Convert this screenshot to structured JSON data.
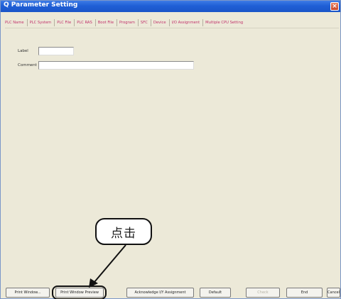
{
  "window": {
    "title": "Q Parameter Setting",
    "close_glyph": "×"
  },
  "tabs": [
    {
      "label": "PLC Name"
    },
    {
      "label": "PLC System"
    },
    {
      "label": "PLC File"
    },
    {
      "label": "PLC RAS"
    },
    {
      "label": "Boot File"
    },
    {
      "label": "Program"
    },
    {
      "label": "SFC"
    },
    {
      "label": "Device"
    },
    {
      "label": "I/O Assignment"
    },
    {
      "label": "Multiple CPU Setting"
    }
  ],
  "form": {
    "label_caption": "Label",
    "label_value": "",
    "comment_caption": "Comment",
    "comment_value": ""
  },
  "callout": {
    "text": "点击"
  },
  "buttons": {
    "print_window": "Print Window...",
    "print_preview": "Print Window Preview",
    "acknowledge": "Acknowledge I/Y Assignment",
    "default": "Default",
    "check": "Check",
    "end": "End",
    "cancel": "Cancel"
  },
  "colors": {
    "tab_text": "#c0306a",
    "titlebar": "#1f5fd6",
    "window_bg": "#ece9d8"
  }
}
